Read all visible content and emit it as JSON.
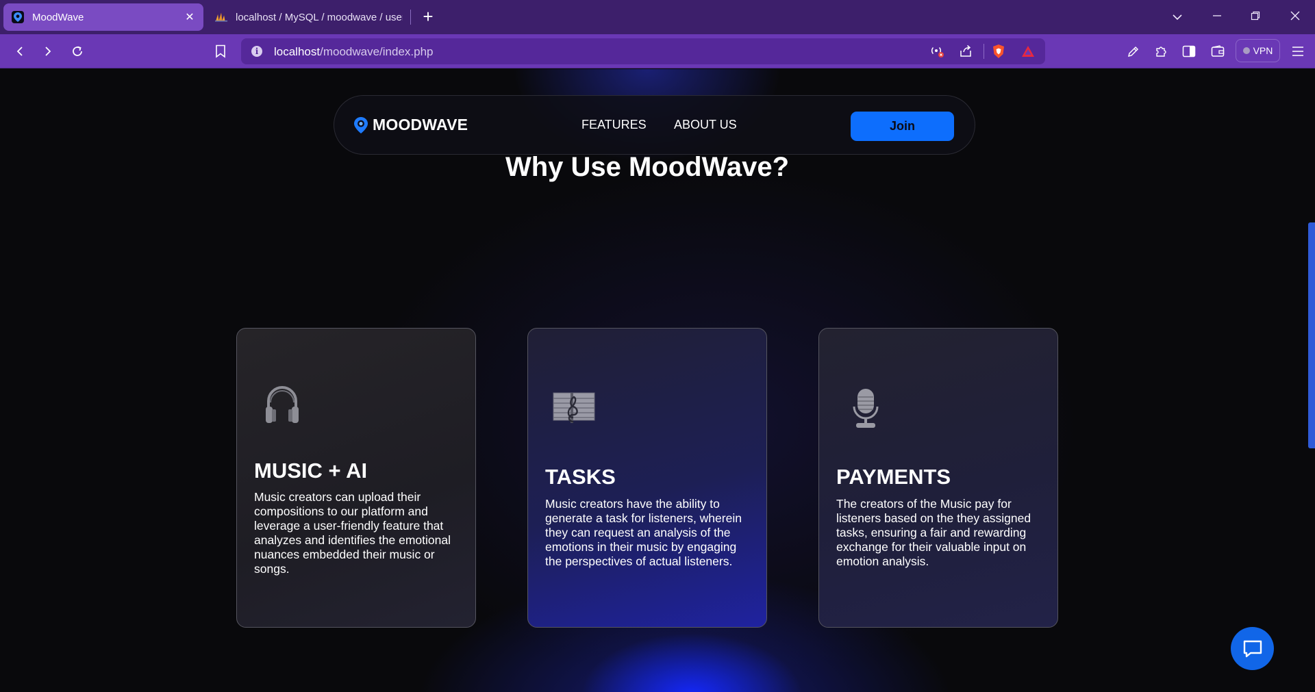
{
  "browser": {
    "tabs": [
      {
        "title": "MoodWave",
        "active": true
      },
      {
        "title": "localhost / MySQL / moodwave / users",
        "active": false
      }
    ],
    "url_host": "localhost",
    "url_path": "/moodwave/index.php",
    "vpn_label": "VPN"
  },
  "navbar": {
    "brand": "MOODWAVE",
    "links": [
      "FEATURES",
      "ABOUT US"
    ],
    "join_label": "Join"
  },
  "headline": "Why Use MoodWave?",
  "cards": [
    {
      "icon": "headphones-icon",
      "title": "MUSIC + AI",
      "text": "Music creators can upload their compositions to our platform and leverage a user-friendly feature that analyzes and identifies the emotional nuances embedded their music or songs."
    },
    {
      "icon": "music-sheet-icon",
      "title": "TASKS",
      "text": "Music creators have the ability to generate a task for listeners, wherein they can request an analysis of the emotions in their music by engaging the perspectives of actual listeners."
    },
    {
      "icon": "microphone-icon",
      "title": "PAYMENTS",
      "text": "The creators of the Music pay for listeners based on the they assigned tasks, ensuring a fair and rewarding exchange for their valuable input on emotion analysis."
    }
  ],
  "colors": {
    "tab_strip": "#3d1f6b",
    "toolbar": "#6a38b5",
    "join_button": "#0d6efd",
    "chat_button": "#1166e8",
    "page_background": "#09090c"
  }
}
